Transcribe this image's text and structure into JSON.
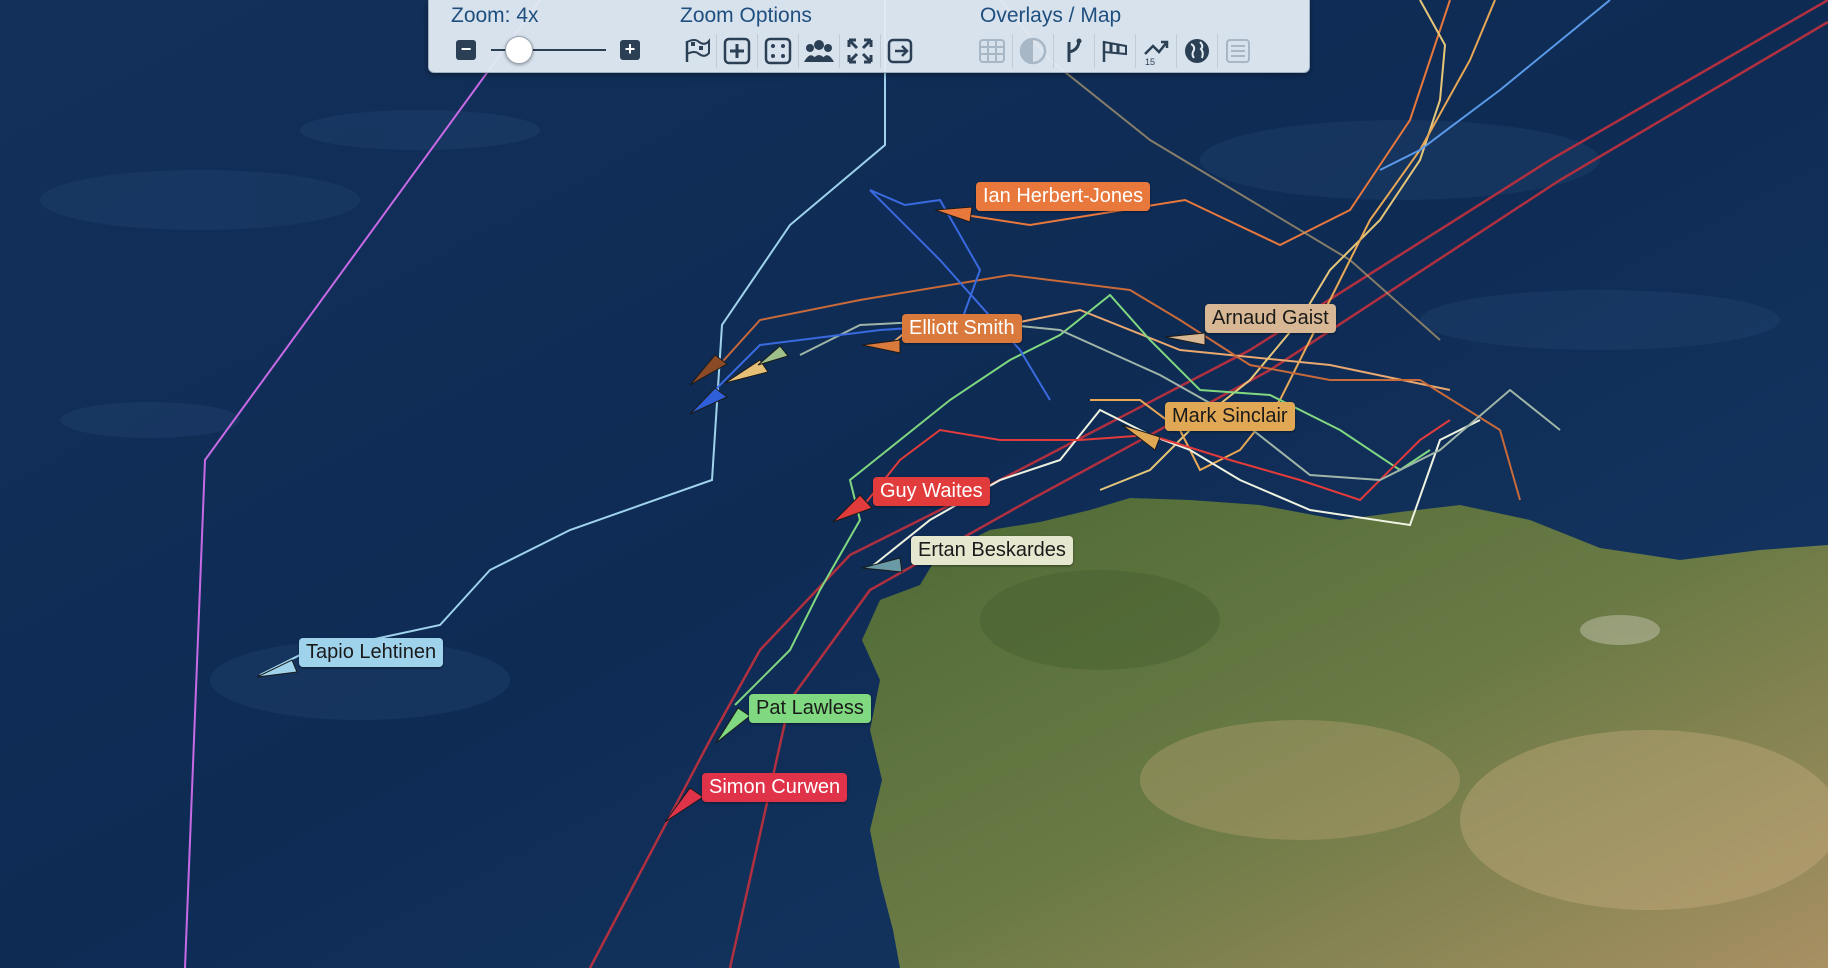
{
  "toolbar": {
    "zoom_label": "Zoom: 4x",
    "zoom_value": 4,
    "zoom_options_label": "Zoom Options",
    "overlays_label": "Overlays / Map",
    "zoom_option_icons": [
      "flag-icon",
      "zoom-in-icon",
      "scatter-icon",
      "group-icon",
      "fit-icon",
      "exit-icon"
    ],
    "overlay_icons": [
      "grid-icon",
      "contrast-icon",
      "route-icon",
      "wind-icon",
      "routing-icon",
      "globe-icon",
      "legend-icon"
    ],
    "routing_badge": "15"
  },
  "boats": [
    {
      "name": "Ian Herbert-Jones",
      "color": "#e8783c",
      "text_color": "#ffffff"
    },
    {
      "name": "Elliott Smith",
      "color": "#d9793c",
      "text_color": "#ffffff"
    },
    {
      "name": "Arnaud Gaist",
      "color": "#d8b894",
      "text_color": "#1a1a1a"
    },
    {
      "name": "Mark Sinclair",
      "color": "#e0a855",
      "text_color": "#1a1a1a"
    },
    {
      "name": "Guy Waites",
      "color": "#e23b3b",
      "text_color": "#ffffff"
    },
    {
      "name": "Ertan Beskardes",
      "color": "#e6e7cf",
      "text_color": "#1a1a1a"
    },
    {
      "name": "Tapio Lehtinen",
      "color": "#9fd3ec",
      "text_color": "#1a1a1a"
    },
    {
      "name": "Pat Lawless",
      "color": "#80d880",
      "text_color": "#1a1a1a"
    },
    {
      "name": "Simon Curwen",
      "color": "#e0334a",
      "text_color": "#ffffff"
    }
  ]
}
